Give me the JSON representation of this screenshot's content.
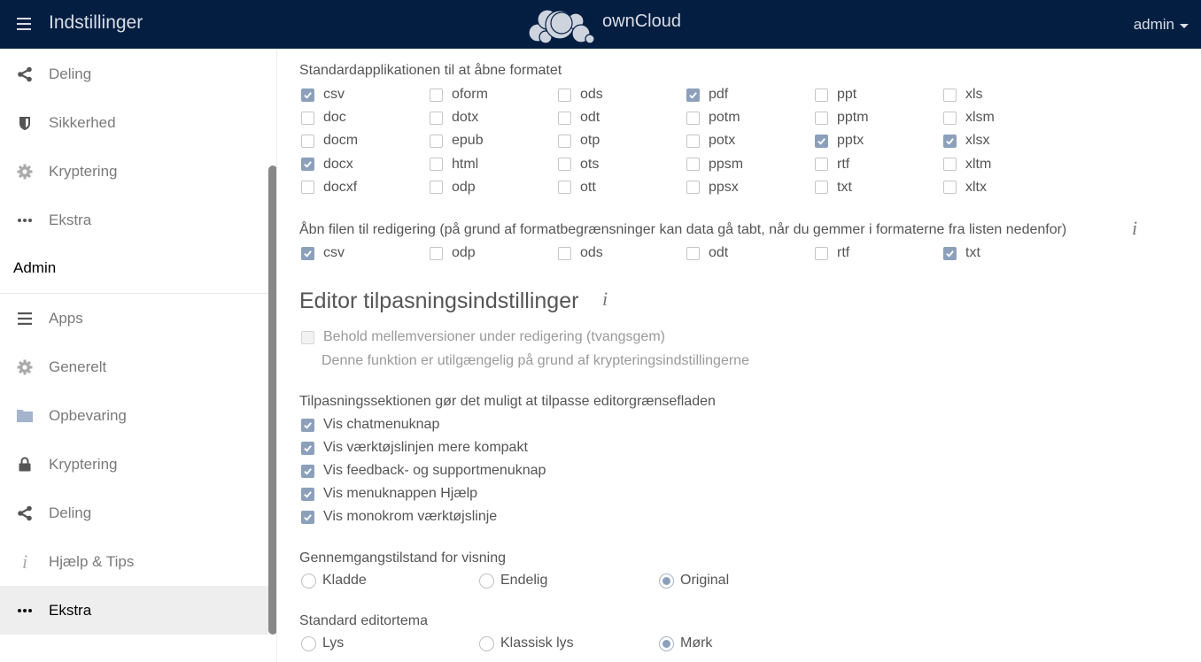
{
  "header": {
    "title": "Indstillinger",
    "brand": "ownCloud",
    "user": "admin"
  },
  "sidebar": {
    "personal_items": [
      {
        "label": "Deling",
        "icon": "share-icon"
      },
      {
        "label": "Sikkerhed",
        "icon": "shield-icon"
      },
      {
        "label": "Kryptering",
        "icon": "gear-icon"
      },
      {
        "label": "Ekstra",
        "icon": "more-dots-icon"
      }
    ],
    "admin_heading": "Admin",
    "admin_items": [
      {
        "label": "Apps",
        "icon": "list-icon"
      },
      {
        "label": "Generelt",
        "icon": "gear-icon"
      },
      {
        "label": "Opbevaring",
        "icon": "folder-icon"
      },
      {
        "label": "Kryptering",
        "icon": "lock-icon"
      },
      {
        "label": "Deling",
        "icon": "share-icon"
      },
      {
        "label": "Hjælp & Tips",
        "icon": "info-icon"
      },
      {
        "label": "Ekstra",
        "icon": "more-dots-icon",
        "active": true
      }
    ]
  },
  "main": {
    "default_apps": {
      "label": "Standardapplikationen til at åbne formatet",
      "columns": [
        [
          {
            "name": "csv",
            "checked": true
          },
          {
            "name": "doc",
            "checked": false
          },
          {
            "name": "docm",
            "checked": false
          },
          {
            "name": "docx",
            "checked": true
          },
          {
            "name": "docxf",
            "checked": false
          }
        ],
        [
          {
            "name": "oform",
            "checked": false
          },
          {
            "name": "dotx",
            "checked": false
          },
          {
            "name": "epub",
            "checked": false
          },
          {
            "name": "html",
            "checked": false
          },
          {
            "name": "odp",
            "checked": false
          }
        ],
        [
          {
            "name": "ods",
            "checked": false
          },
          {
            "name": "odt",
            "checked": false
          },
          {
            "name": "otp",
            "checked": false
          },
          {
            "name": "ots",
            "checked": false
          },
          {
            "name": "ott",
            "checked": false
          }
        ],
        [
          {
            "name": "pdf",
            "checked": true
          },
          {
            "name": "potm",
            "checked": false
          },
          {
            "name": "potx",
            "checked": false
          },
          {
            "name": "ppsm",
            "checked": false
          },
          {
            "name": "ppsx",
            "checked": false
          }
        ],
        [
          {
            "name": "ppt",
            "checked": false
          },
          {
            "name": "pptm",
            "checked": false
          },
          {
            "name": "pptx",
            "checked": true
          },
          {
            "name": "rtf",
            "checked": false
          },
          {
            "name": "txt",
            "checked": false
          }
        ],
        [
          {
            "name": "xls",
            "checked": false
          },
          {
            "name": "xlsm",
            "checked": false
          },
          {
            "name": "xlsx",
            "checked": true
          },
          {
            "name": "xltm",
            "checked": false
          },
          {
            "name": "xltx",
            "checked": false
          }
        ]
      ]
    },
    "edit_formats": {
      "label": "Åbn filen til redigering (på grund af formatbegrænsninger kan data gå tabt, når du gemmer i formaterne fra listen nedenfor)",
      "items": [
        {
          "name": "csv",
          "checked": true
        },
        {
          "name": "odp",
          "checked": false
        },
        {
          "name": "ods",
          "checked": false
        },
        {
          "name": "odt",
          "checked": false
        },
        {
          "name": "rtf",
          "checked": false
        },
        {
          "name": "txt",
          "checked": true
        }
      ]
    },
    "customization": {
      "heading": "Editor tilpasningsindstillinger",
      "forcesave_label": "Behold mellemversioner under redigering (tvangsgem)",
      "forcesave_checked": false,
      "forcesave_note": "Denne funktion er utilgængelig på grund af krypteringsindstillingerne",
      "section_label": "Tilpasningssektionen gør det muligt at tilpasse editorgrænsefladen",
      "options": [
        {
          "label": "Vis chatmenuknap",
          "checked": true
        },
        {
          "label": "Vis værktøjslinjen mere kompakt",
          "checked": true
        },
        {
          "label": "Vis feedback- og supportmenuknap",
          "checked": true
        },
        {
          "label": "Vis menuknappen Hjælp",
          "checked": true
        },
        {
          "label": "Vis monokrom værktøjslinje",
          "checked": true
        }
      ]
    },
    "review_mode": {
      "label": "Gennemgangstilstand for visning",
      "options": [
        "Kladde",
        "Endelig",
        "Original"
      ],
      "selected": "Original"
    },
    "theme": {
      "label": "Standard editortema",
      "options": [
        "Lys",
        "Klassisk lys",
        "Mørk"
      ],
      "selected": "Mørk"
    }
  },
  "colors": {
    "header_bg": "#041e42",
    "accent": "#8ca0bb"
  }
}
